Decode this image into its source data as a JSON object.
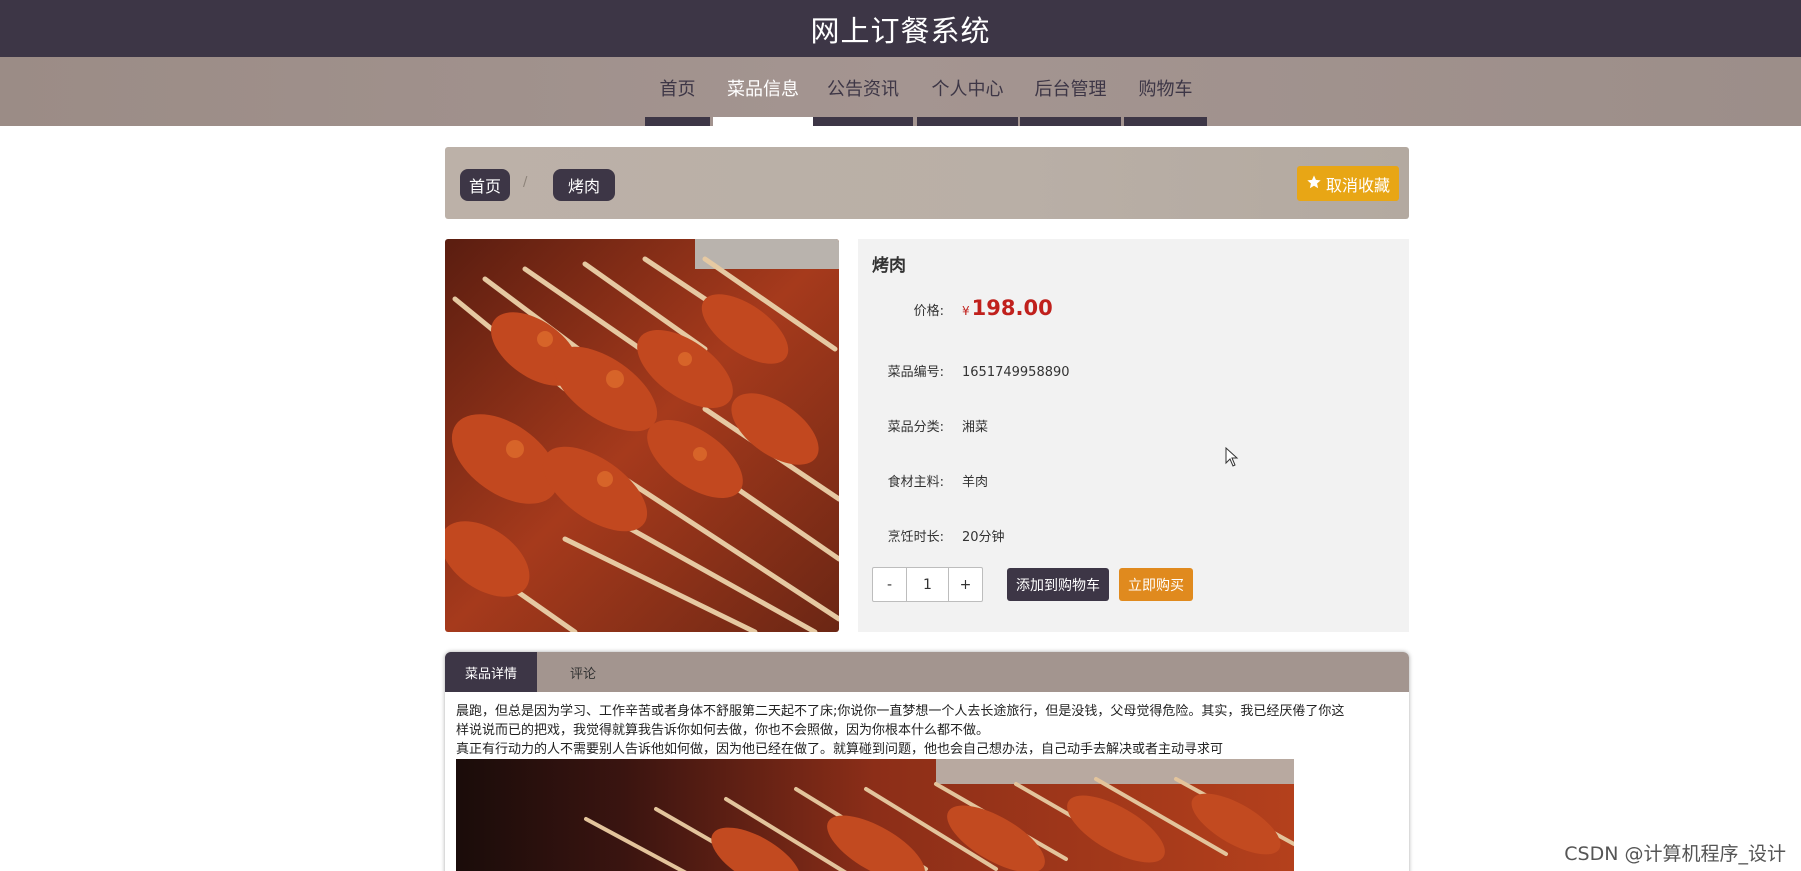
{
  "header": {
    "site_title": "网上订餐系统"
  },
  "nav": {
    "items": [
      {
        "label": "首页",
        "active": false
      },
      {
        "label": "菜品信息",
        "active": true
      },
      {
        "label": "公告资讯",
        "active": false
      },
      {
        "label": "个人中心",
        "active": false
      },
      {
        "label": "后台管理",
        "active": false
      },
      {
        "label": "购物车",
        "active": false
      }
    ]
  },
  "breadcrumb": {
    "home": "首页",
    "separator": "/",
    "current": "烤肉",
    "favorite_button": "取消收藏"
  },
  "product": {
    "name": "烤肉",
    "price_label": "价格:",
    "currency": "¥",
    "price": "198.00",
    "fields": [
      {
        "label": "菜品编号:",
        "value": "1651749958890"
      },
      {
        "label": "菜品分类:",
        "value": "湘菜"
      },
      {
        "label": "食材主料:",
        "value": "羊肉"
      },
      {
        "label": "烹饪时长:",
        "value": "20分钟"
      }
    ],
    "quantity": "1",
    "minus": "-",
    "plus": "+",
    "add_to_cart": "添加到购物车",
    "buy_now": "立即购买"
  },
  "tabs": {
    "items": [
      {
        "label": "菜品详情",
        "active": true
      },
      {
        "label": "评论",
        "active": false
      }
    ],
    "detail_lines": [
      "晨跑，但总是因为学习、工作辛苦或者身体不舒服第二天起不了床;你说你一直梦想一个人去长途旅行，但是没钱，父母觉得危险。其实，我已经厌倦了你这",
      "样说说而已的把戏，我觉得就算我告诉你如何去做，你也不会照做，因为你根本什么都不做。",
      "真正有行动力的人不需要别人告诉他如何做，因为他已经在做了。就算碰到问题，他也会自己想办法，自己动手去解决或者主动寻求可"
    ]
  },
  "colors": {
    "dark": "#3d3646",
    "nav_bg": "#a3958f",
    "accent_yellow": "#e8a615",
    "accent_orange": "#e08a1e",
    "price_red": "#c0201c"
  },
  "watermark": "CSDN @计算机程序_设计"
}
